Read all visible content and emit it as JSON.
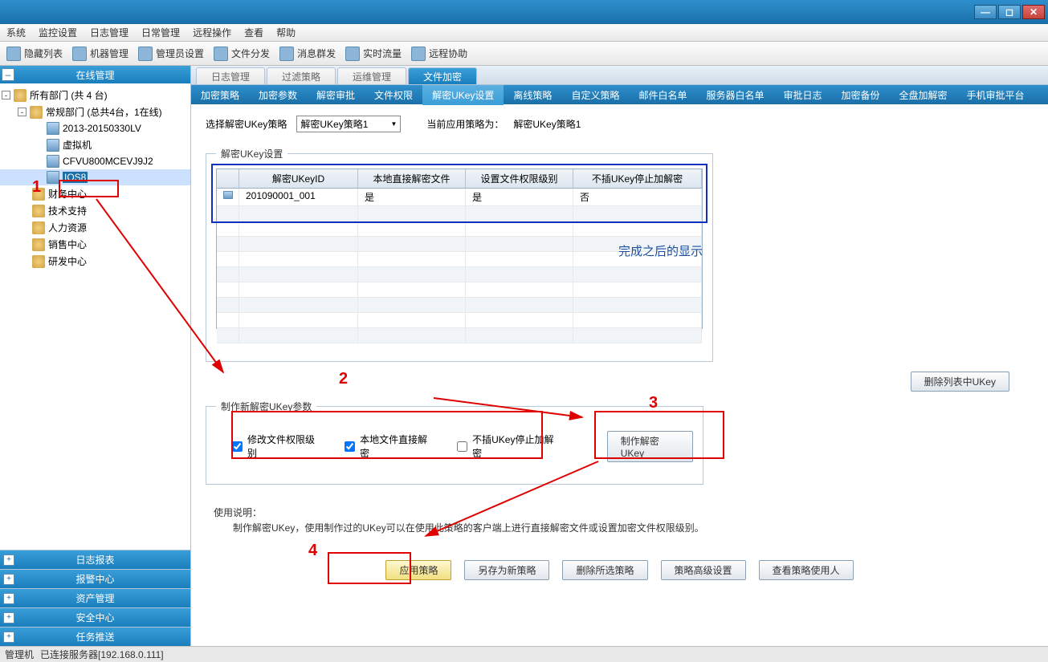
{
  "menubar": [
    "系统",
    "监控设置",
    "日志管理",
    "日常管理",
    "远程操作",
    "查看",
    "帮助"
  ],
  "toolbar": [
    {
      "label": "隐藏列表"
    },
    {
      "label": "机器管理"
    },
    {
      "label": "管理员设置"
    },
    {
      "label": "文件分发"
    },
    {
      "label": "消息群发"
    },
    {
      "label": "实时流量"
    },
    {
      "label": "远程协助"
    }
  ],
  "sidebar": {
    "header": "在线管理",
    "root": "所有部门 (共 4 台)",
    "dept": "常规部门 (总共4台，1在线)",
    "machines": [
      "2013-20150330LV",
      "虚拟机",
      "CFVU800MCEVJ9J2",
      "IOS8"
    ],
    "depts": [
      "财务中心",
      "技术支持",
      "人力资源",
      "销售中心",
      "研发中心"
    ],
    "panels": [
      "日志报表",
      "报警中心",
      "资产管理",
      "安全中心",
      "任务推送"
    ]
  },
  "tabsUpper": [
    "日志管理",
    "过滤策略",
    "运维管理",
    "文件加密"
  ],
  "tabsLower": [
    "加密策略",
    "加密参数",
    "解密审批",
    "文件权限",
    "解密UKey设置",
    "离线策略",
    "自定义策略",
    "邮件白名单",
    "服务器白名单",
    "审批日志",
    "加密备份",
    "全盘加解密",
    "手机审批平台"
  ],
  "policy": {
    "selectLabel": "选择解密UKey策略",
    "comboValue": "解密UKey策略1",
    "currentLabel": "当前应用策略为：",
    "currentValue": "解密UKey策略1"
  },
  "fieldset1": {
    "legend": "解密UKey设置",
    "headers": [
      "解密UKeyID",
      "本地直接解密文件",
      "设置文件权限级别",
      "不插UKey停止加解密"
    ],
    "row": [
      "201090001_001",
      "是",
      "是",
      "否"
    ],
    "doneLabel": "完成之后的显示"
  },
  "deleteBtn": "删除列表中UKey",
  "fieldset2": {
    "legend": "制作新解密UKey参数",
    "chk1": "修改文件权限级别",
    "chk2": "本地文件直接解密",
    "chk3": "不插UKey停止加解密",
    "makeBtn": "制作解密UKey"
  },
  "usage": {
    "title": "使用说明：",
    "text": "制作解密UKey，使用制作过的UKey可以在使用此策略的客户端上进行直接解密文件或设置加密文件权限级别。"
  },
  "bottomBtns": [
    "应用策略",
    "另存为新策略",
    "删除所选策略",
    "策略高级设置",
    "查看策略使用人"
  ],
  "status": {
    "left": "管理机",
    "right": "已连接服务器[192.168.0.111]"
  },
  "annot": {
    "n1": "1",
    "n2": "2",
    "n3": "3",
    "n4": "4"
  }
}
